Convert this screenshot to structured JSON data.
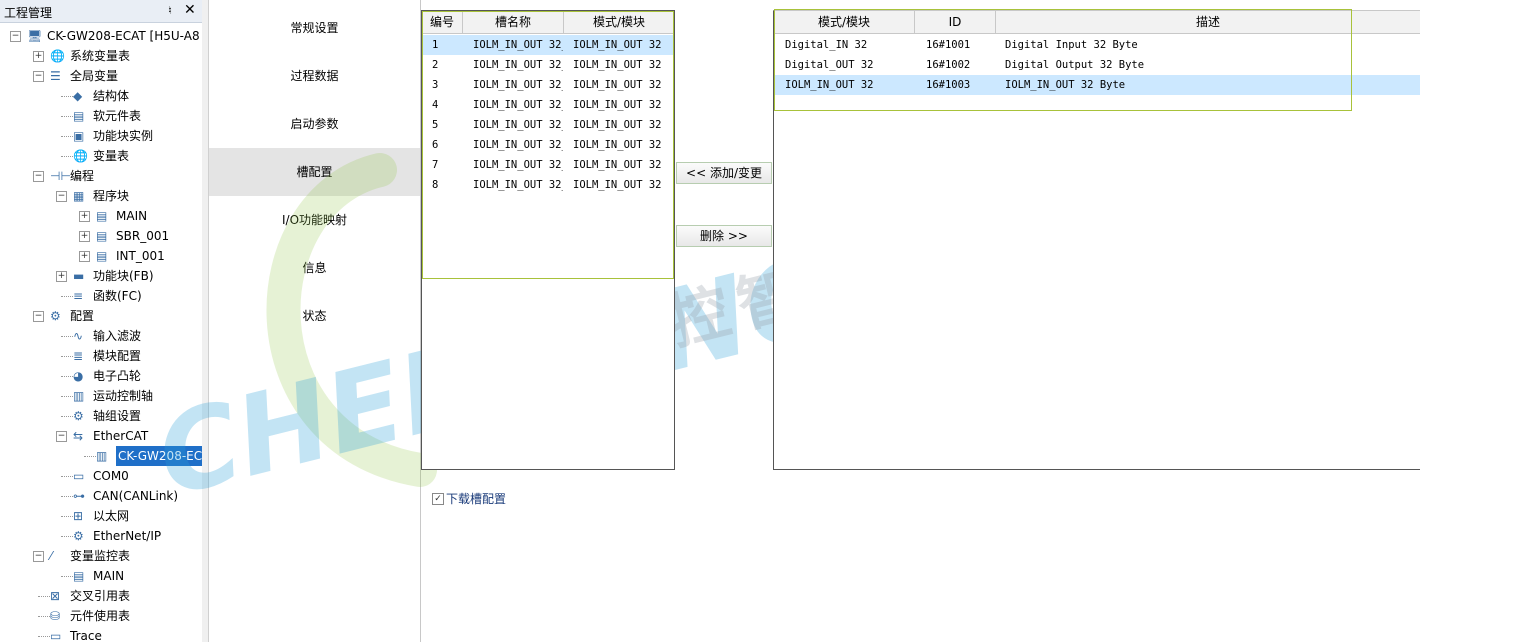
{
  "panel": {
    "title": "工程管理",
    "pin": "♮",
    "close": "✕"
  },
  "tree": [
    {
      "label": "CK-GW208-ECAT [H5U-A8",
      "icon": "computer-icon"
    },
    {
      "label": "系统变量表",
      "icon": "globe-icon"
    },
    {
      "label": "全局变量",
      "icon": "list-icon"
    },
    {
      "label": "结构体",
      "icon": "struct-icon"
    },
    {
      "label": "软元件表",
      "icon": "table-icon"
    },
    {
      "label": "功能块实例",
      "icon": "cube-icon"
    },
    {
      "label": "变量表",
      "icon": "globe-icon"
    },
    {
      "label": "编程",
      "icon": "ladder-icon"
    },
    {
      "label": "程序块",
      "icon": "blocks-icon"
    },
    {
      "label": "MAIN",
      "icon": "program-icon"
    },
    {
      "label": "SBR_001",
      "icon": "program-icon"
    },
    {
      "label": "INT_001",
      "icon": "program-icon"
    },
    {
      "label": "功能块(FB)",
      "icon": "fb-icon"
    },
    {
      "label": "函数(FC)",
      "icon": "fc-icon"
    },
    {
      "label": "配置",
      "icon": "config-icon"
    },
    {
      "label": "输入滤波",
      "icon": "filter-icon"
    },
    {
      "label": "模块配置",
      "icon": "module-icon"
    },
    {
      "label": "电子凸轮",
      "icon": "cam-icon"
    },
    {
      "label": "运动控制轴",
      "icon": "axis-icon"
    },
    {
      "label": "轴组设置",
      "icon": "gear-icon"
    },
    {
      "label": "EtherCAT",
      "icon": "ethercat-icon"
    },
    {
      "label": "CK-GW208-EC",
      "icon": "device-icon"
    },
    {
      "label": "COM0",
      "icon": "serial-icon"
    },
    {
      "label": "CAN(CANLink)",
      "icon": "can-icon"
    },
    {
      "label": "以太网",
      "icon": "ethernet-icon"
    },
    {
      "label": "EtherNet/IP",
      "icon": "enip-icon"
    },
    {
      "label": "变量监控表",
      "icon": "monitor-icon"
    },
    {
      "label": "MAIN",
      "icon": "table-icon"
    },
    {
      "label": "交叉引用表",
      "icon": "crossref-icon"
    },
    {
      "label": "元件使用表",
      "icon": "database-icon"
    },
    {
      "label": "Trace",
      "icon": "trace-icon"
    }
  ],
  "nav": {
    "tabs": [
      "常规设置",
      "过程数据",
      "启动参数",
      "槽配置",
      "I/O功能映射",
      "信息",
      "状态"
    ],
    "active_index": 3
  },
  "slot_table": {
    "headers": [
      "编号",
      "槽名称",
      "模式/模块"
    ],
    "rows": [
      {
        "no": "1",
        "name": "IOLM_IN_OUT 32_",
        "mode": "IOLM_IN_OUT 32"
      },
      {
        "no": "2",
        "name": "IOLM_IN_OUT 32_",
        "mode": "IOLM_IN_OUT 32"
      },
      {
        "no": "3",
        "name": "IOLM_IN_OUT 32_",
        "mode": "IOLM_IN_OUT 32"
      },
      {
        "no": "4",
        "name": "IOLM_IN_OUT 32_",
        "mode": "IOLM_IN_OUT 32"
      },
      {
        "no": "5",
        "name": "IOLM_IN_OUT 32_",
        "mode": "IOLM_IN_OUT 32"
      },
      {
        "no": "6",
        "name": "IOLM_IN_OUT 32_",
        "mode": "IOLM_IN_OUT 32"
      },
      {
        "no": "7",
        "name": "IOLM_IN_OUT 32_",
        "mode": "IOLM_IN_OUT 32"
      },
      {
        "no": "8",
        "name": "IOLM_IN_OUT 32_",
        "mode": "IOLM_IN_OUT 32"
      }
    ],
    "selected_index": 0
  },
  "buttons": {
    "add": "<< 添加/变更",
    "delete": "删除 >>"
  },
  "module_table": {
    "headers": [
      "模式/模块",
      "ID",
      "描述"
    ],
    "rows": [
      {
        "mode": "Digital_IN 32",
        "id": "16#1001",
        "desc": "Digital Input 32 Byte"
      },
      {
        "mode": "Digital_OUT 32",
        "id": "16#1002",
        "desc": "Digital Output 32 Byte"
      },
      {
        "mode": "IOLM_IN_OUT 32",
        "id": "16#1003",
        "desc": "IOLM_IN_OUT 32 Byte"
      }
    ],
    "selected_index": 2
  },
  "download_checkbox": {
    "label": "下载槽配置",
    "checked": true
  },
  "watermark": {
    "brand": "CHENKONG",
    "chinese": "晨控智能",
    "registered": "®"
  },
  "colors": {
    "selection": "#cce8ff",
    "tree_selected": "#1f6fc8",
    "highlight_border": "#a8c23a",
    "watermark_blue": "#2a9fd8",
    "watermark_green": "#8dc63f",
    "arrow": "#e8322b"
  }
}
